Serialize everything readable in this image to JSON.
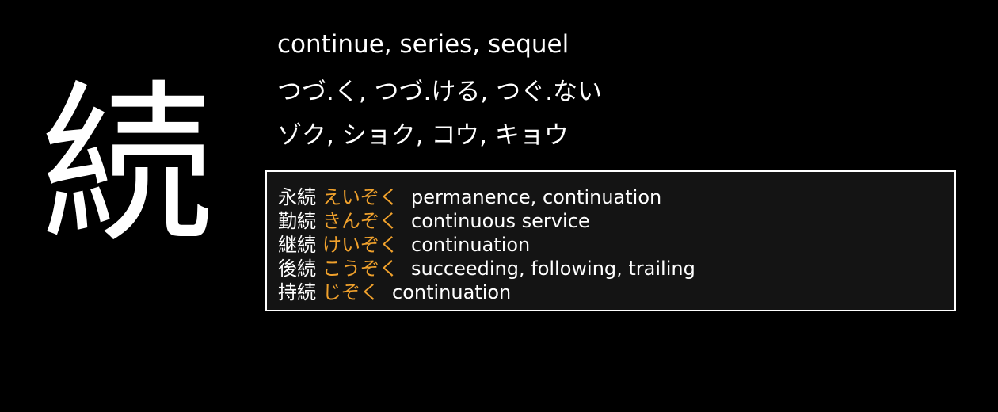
{
  "kanji": {
    "character": "続",
    "meaning": "continue, series, sequel",
    "kun_readings": "つづ.く, つづ.ける, つぐ.ない",
    "on_readings": "ゾク, ショク, コウ, キョウ"
  },
  "vocabulary": [
    {
      "word": "永続",
      "reading": "えいぞく",
      "definition": "permanence, continuation"
    },
    {
      "word": "勤続",
      "reading": "きんぞく",
      "definition": "continuous service"
    },
    {
      "word": "継続",
      "reading": "けいぞく",
      "definition": "continuation"
    },
    {
      "word": "後続",
      "reading": "こうぞく",
      "definition": "succeeding, following, trailing"
    },
    {
      "word": "持続",
      "reading": "じぞく",
      "definition": "continuation"
    }
  ],
  "colors": {
    "background": "#000000",
    "text": "#ffffff",
    "reading_accent": "#f0a12c",
    "box_background": "#141414",
    "box_border": "#ffffff"
  }
}
